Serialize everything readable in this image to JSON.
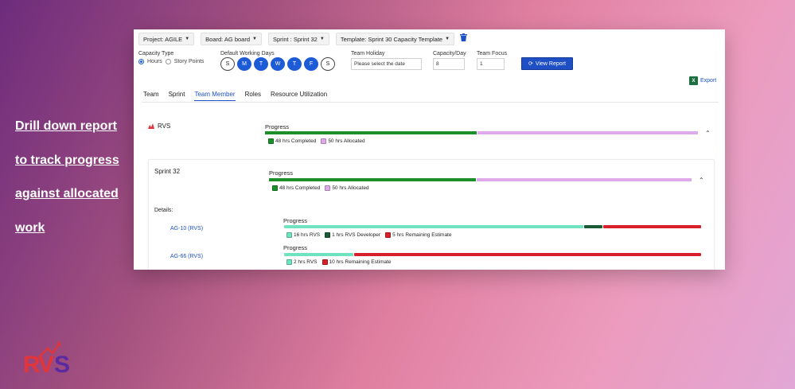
{
  "promo": {
    "lines": [
      "Drill down report",
      "to track progress",
      "against allocated",
      "work"
    ]
  },
  "brand": {
    "logo_text": "RVS",
    "colors": {
      "logo_red": "#e0353b",
      "logo_purple": "#5a2aa0"
    }
  },
  "filters": {
    "project": "Project: AGILE",
    "board": "Board: AG board",
    "sprint": "Sprint : Sprint 32",
    "template": "Template: Sprint 30 Capacity Template"
  },
  "capacity": {
    "type_label": "Capacity Type",
    "options": [
      "Hours",
      "Story Points"
    ],
    "selected": "Hours"
  },
  "working_days": {
    "label": "Default Working Days",
    "days": [
      {
        "letter": "S",
        "active": false
      },
      {
        "letter": "M",
        "active": true
      },
      {
        "letter": "T",
        "active": true
      },
      {
        "letter": "W",
        "active": true
      },
      {
        "letter": "T",
        "active": true
      },
      {
        "letter": "F",
        "active": true
      },
      {
        "letter": "S",
        "active": false
      }
    ]
  },
  "team_holiday": {
    "label": "Team Holiday",
    "placeholder": "Please select the date"
  },
  "capacity_day": {
    "label": "Capacity/Day",
    "value": "8"
  },
  "team_focus": {
    "label": "Team Focus",
    "value": "1"
  },
  "view_report": "View Report",
  "export": "Export",
  "tabs": [
    {
      "label": "Team",
      "active": false
    },
    {
      "label": "Sprint",
      "active": false
    },
    {
      "label": "Team Member",
      "active": true
    },
    {
      "label": "Roles",
      "active": false
    },
    {
      "label": "Resource Utilization",
      "active": false
    }
  ],
  "member": {
    "name": "RVS",
    "progress_title": "Progress",
    "completed_fraction": 0.49,
    "legend": [
      {
        "label": "48 hrs Completed",
        "color": "#1a8f2a"
      },
      {
        "label": "50 hrs Allocated",
        "color": "#dfaaea"
      }
    ]
  },
  "sprint": {
    "name": "Sprint 32",
    "progress_title": "Progress",
    "completed_fraction": 0.49,
    "legend": [
      {
        "label": "48 hrs Completed",
        "color": "#1a8f2a"
      },
      {
        "label": "50 hrs Allocated",
        "color": "#dfaaea"
      }
    ],
    "details_label": "Details:"
  },
  "issues": [
    {
      "key": "AG-10 (RVS)",
      "progress_title": "Progress",
      "segments": [
        {
          "fraction": 0.72,
          "color": "#6fe3bf"
        },
        {
          "fraction": 0.045,
          "color": "#1c5a36"
        },
        {
          "fraction": 0.235,
          "color": "#d9202a"
        }
      ],
      "legend": [
        {
          "label": "16 hrs RVS",
          "color": "#6fe3bf"
        },
        {
          "label": "1 hrs RVS Developer",
          "color": "#1c5a36"
        },
        {
          "label": "5 hrs Remaining Estimate",
          "color": "#d9202a"
        }
      ]
    },
    {
      "key": "AG-66 (RVS)",
      "progress_title": "Progress",
      "segments": [
        {
          "fraction": 0.167,
          "color": "#6fe3bf"
        },
        {
          "fraction": 0.833,
          "color": "#d9202a"
        }
      ],
      "legend": [
        {
          "label": "2 hrs RVS",
          "color": "#6fe3bf"
        },
        {
          "label": "10 hrs Remaining Estimate",
          "color": "#d9202a"
        }
      ]
    }
  ]
}
